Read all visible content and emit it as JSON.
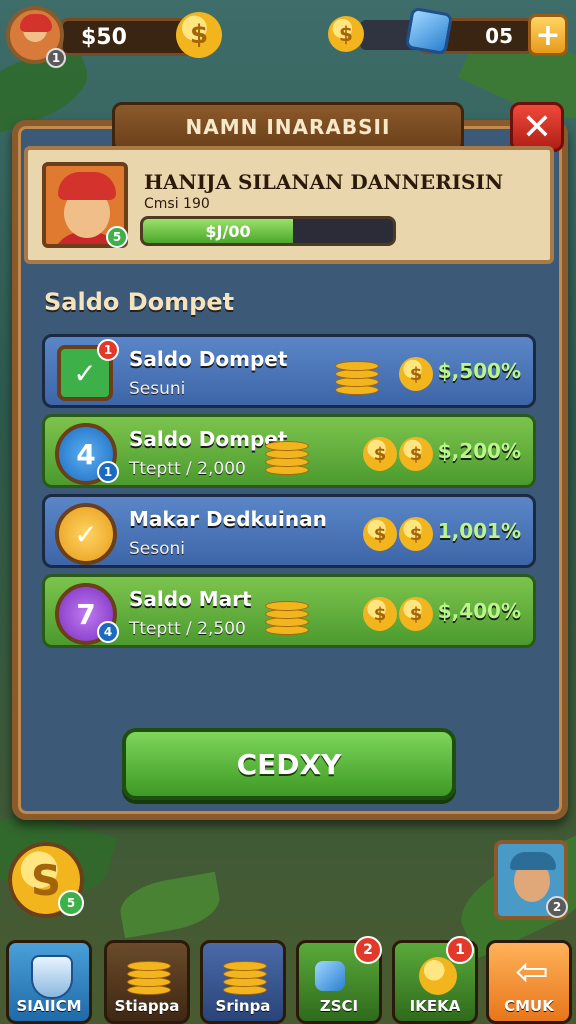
{
  "top_bar": {
    "money": "$50",
    "level_badge": "1",
    "coin_symbol": "$",
    "gems": "05",
    "plus": "+"
  },
  "dialog": {
    "title": "NAMN INARABSII",
    "close": "✕",
    "profile": {
      "name": "HANIJA SILANAN DANNERISIN",
      "sub": "Cmsi 190",
      "level_badge": "5",
      "progress_label": "$J/00",
      "progress_fraction": 0.6
    },
    "section_title": "Saldo Dompet",
    "rows": [
      {
        "title": "Saldo Dompet",
        "sub": "Sesuni",
        "value": "$,500%",
        "icon_text": "✓",
        "badge": "1",
        "style": "blue"
      },
      {
        "title": "Saldo Dompet",
        "sub": "Tteptt / 2,000",
        "value": "$,200%",
        "icon_text": "4",
        "badge": "1",
        "style": "green"
      },
      {
        "title": "Makar Dedkuinan",
        "sub": "Sesoni",
        "value": "1,001%",
        "icon_text": "✓",
        "badge": "",
        "style": "blue"
      },
      {
        "title": "Saldo Mart",
        "sub": "Tteptt / 2,500",
        "value": "$,400%",
        "icon_text": "7",
        "badge": "4",
        "style": "green"
      }
    ],
    "confirm": "CEDXY"
  },
  "side": {
    "coin_symbol": "S",
    "coin_badge": "5",
    "char_badge": "2"
  },
  "nav": [
    {
      "label": "SIAIICM",
      "badge": ""
    },
    {
      "label": "Stiappa",
      "badge": ""
    },
    {
      "label": "Srinpa",
      "badge": ""
    },
    {
      "label": "ZSCI",
      "badge": "2"
    },
    {
      "label": "IKEKA",
      "badge": "1"
    },
    {
      "label": "CMUK",
      "badge": ""
    }
  ],
  "colors": {
    "panel": "#3c5a78",
    "wood": "#8b5a2b",
    "green_button": "#4aa82a",
    "close_red": "#d4322c",
    "gold": "#f2b51e"
  }
}
